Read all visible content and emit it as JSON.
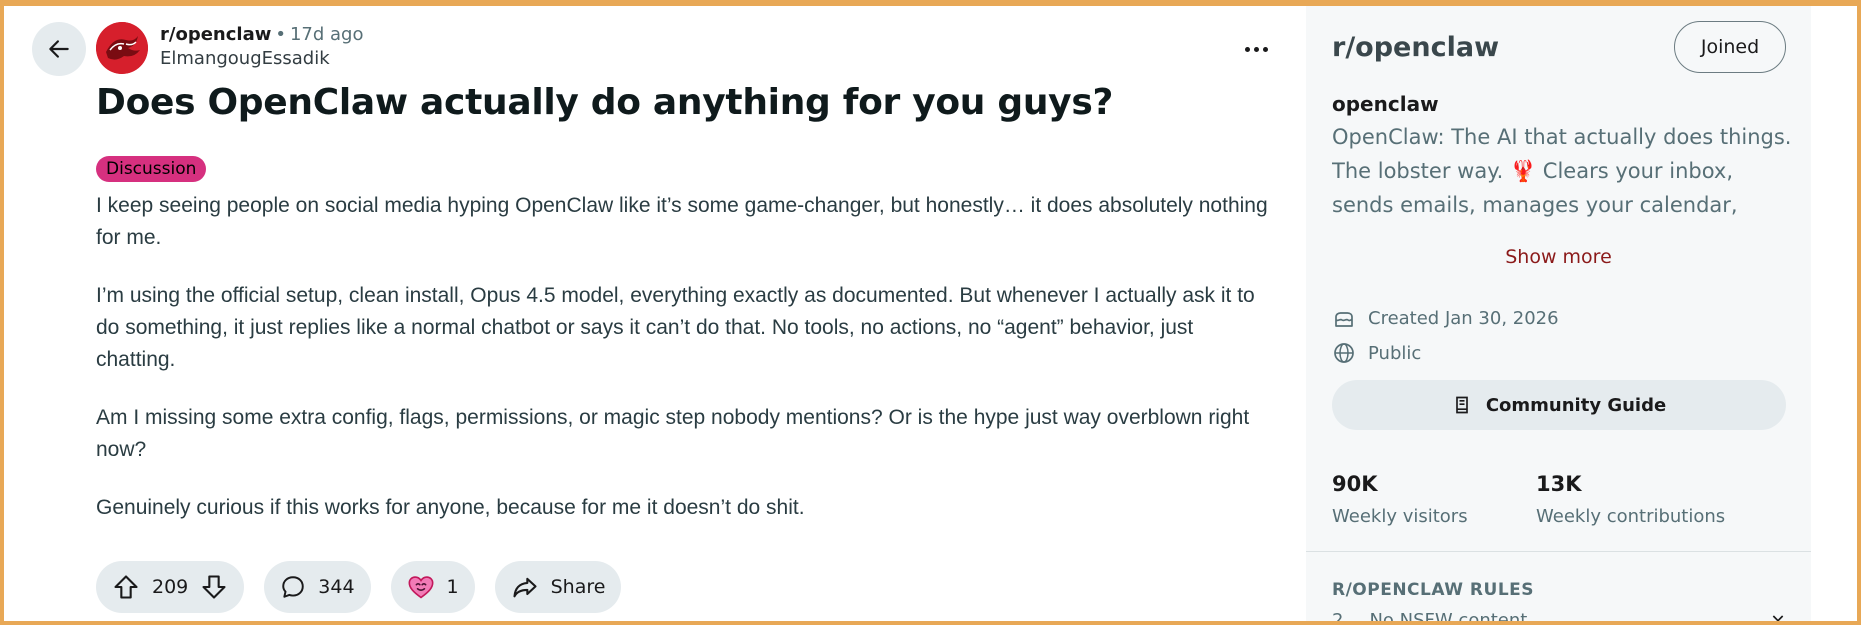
{
  "post": {
    "subreddit": "r/openclaw",
    "separator": "•",
    "time_ago": "17d ago",
    "author": "ElmangougEssadik",
    "title": "Does OpenClaw actually do anything for you guys?",
    "flair": "Discussion",
    "flair_color": "#d6307f",
    "paragraphs": [
      "I keep seeing people on social media hyping OpenClaw like it’s some game-changer, but honestly… it does absolutely nothing for me.",
      "I’m using the official setup, clean install, Opus 4.5 model, everything exactly as documented. But whenever I actually ask it to do something, it just replies like a normal chatbot or says it can’t do that. No tools, no actions, no “agent” behavior, just chatting.",
      "Am I missing some extra config, flags, permissions, or magic step nobody mentions? Or is the hype just way overblown right now?",
      "Genuinely curious if this works for anyone, because for me it doesn’t do shit."
    ],
    "actions": {
      "votes": "209",
      "comments": "344",
      "awards": "1",
      "share_label": "Share"
    }
  },
  "sidebar": {
    "title": "r/openclaw",
    "joined_label": "Joined",
    "name": "openclaw",
    "description": "OpenClaw: The AI that actually does things. The lobster way. 🦞 Clears your inbox, sends emails, manages your calendar, checks you i...",
    "show_more_label": "Show more",
    "created": "Created Jan 30, 2026",
    "visibility": "Public",
    "guide_label": "Community Guide",
    "stats": [
      {
        "value": "90K",
        "label": "Weekly visitors"
      },
      {
        "value": "13K",
        "label": "Weekly contributions"
      }
    ],
    "rules_heading": "R/OPENCLAW RULES",
    "rules_peek_number": "2",
    "rules_peek_text": "No NSFW content"
  },
  "colors": {
    "accent_show_more": "#8b1a1a",
    "pill_bg": "#e5ebee",
    "avatar_red": "#d61f2c"
  },
  "icons": [
    "back-arrow-icon",
    "more-icon",
    "upvote-icon",
    "downvote-icon",
    "comment-icon",
    "award-icon",
    "share-icon",
    "cake-icon",
    "globe-icon",
    "book-icon",
    "chevron-down-icon"
  ]
}
